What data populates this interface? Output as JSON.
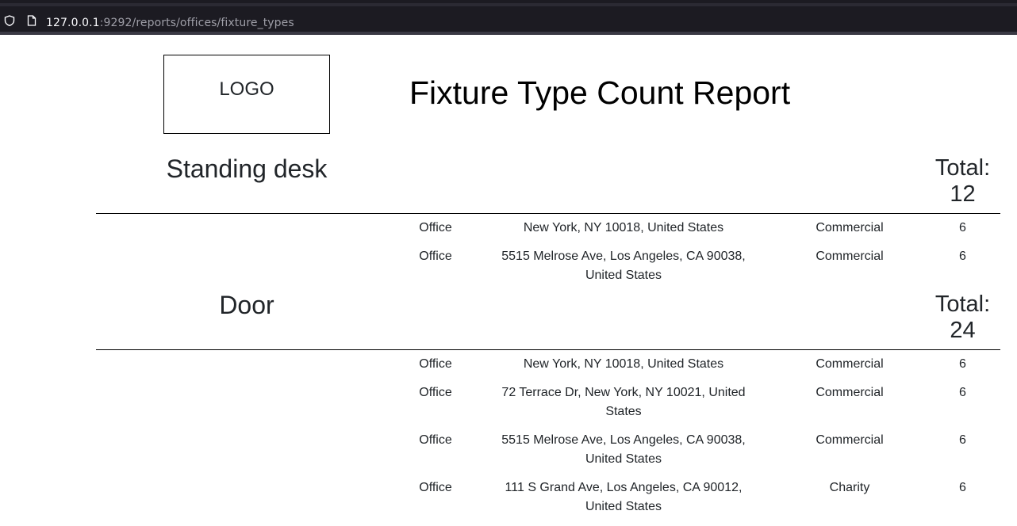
{
  "browser": {
    "url_host": "127.0.0.1",
    "url_rest": ":9292/reports/offices/fixture_types"
  },
  "header": {
    "logo": "LOGO",
    "title": "Fixture Type Count Report"
  },
  "groups": [
    {
      "name": "Standing desk",
      "total_label": "Total:",
      "total": "12",
      "rows": [
        {
          "type": "Office",
          "address": "New York, NY 10018, United States",
          "category": "Commercial",
          "count": "6"
        },
        {
          "type": "Office",
          "address_line1": "5515 Melrose Ave, Los Angeles, CA 90038,",
          "address_line2": "United States",
          "category": "Commercial",
          "count": "6"
        }
      ]
    },
    {
      "name": "Door",
      "total_label": "Total:",
      "total": "24",
      "rows": [
        {
          "type": "Office",
          "address": "New York, NY 10018, United States",
          "category": "Commercial",
          "count": "6"
        },
        {
          "type": "Office",
          "address_line1": "72 Terrace Dr, New York, NY 10021, United",
          "address_line2": "States",
          "category": "Commercial",
          "count": "6"
        },
        {
          "type": "Office",
          "address_line1": "5515 Melrose Ave, Los Angeles, CA 90038,",
          "address_line2": "United States",
          "category": "Commercial",
          "count": "6"
        },
        {
          "type": "Office",
          "address_line1": "111 S Grand Ave, Los Angeles, CA 90012,",
          "address_line2": "United States",
          "category": "Charity",
          "count": "6"
        }
      ]
    }
  ]
}
